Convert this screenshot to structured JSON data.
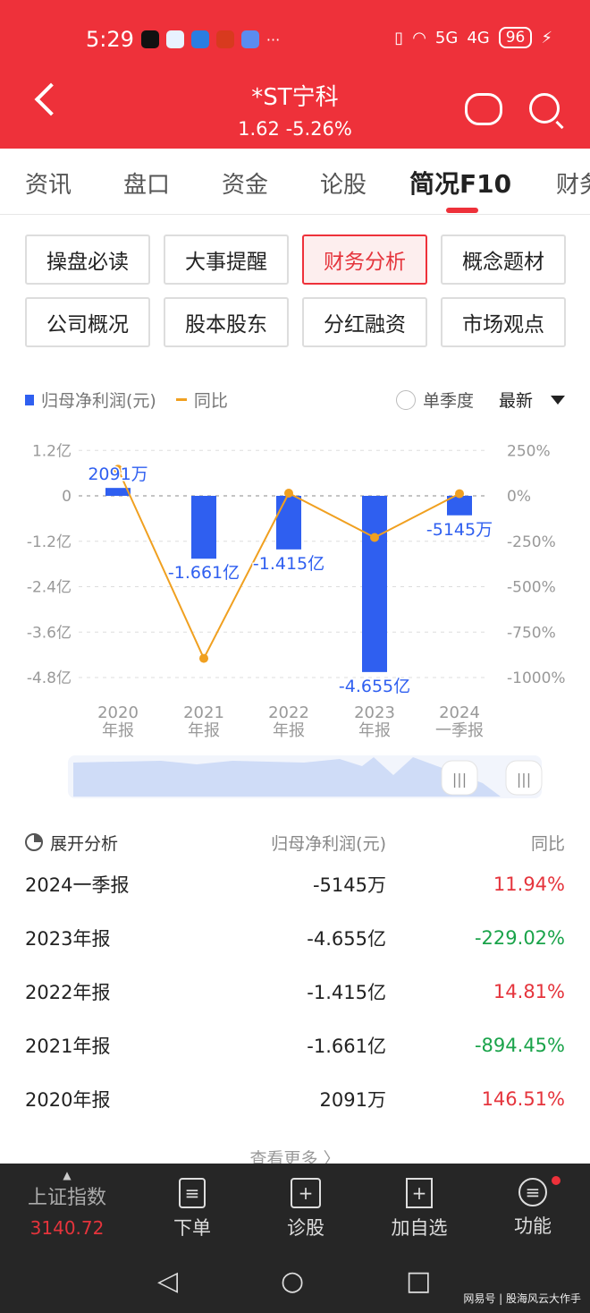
{
  "status_bar": {
    "time": "5:29",
    "battery": "96",
    "network": [
      "5G",
      "4G"
    ]
  },
  "header": {
    "title": "*ST宁科",
    "price": "1.62",
    "change": "-5.26%"
  },
  "tabs": [
    {
      "label": "资讯"
    },
    {
      "label": "盘口"
    },
    {
      "label": "资金"
    },
    {
      "label": "论股"
    },
    {
      "label": "简况F10",
      "active": true
    },
    {
      "label": "财务"
    }
  ],
  "buttons": [
    {
      "label": "操盘必读"
    },
    {
      "label": "大事提醒"
    },
    {
      "label": "财务分析",
      "selected": true
    },
    {
      "label": "概念题材"
    },
    {
      "label": "公司概况"
    },
    {
      "label": "股本股东"
    },
    {
      "label": "分红融资"
    },
    {
      "label": "市场观点"
    }
  ],
  "chart_controls": {
    "single_quarter": "单季度",
    "sort": "最新"
  },
  "chart_data": {
    "type": "bar+line",
    "categories": [
      "2020\n年报",
      "2021\n年报",
      "2022\n年报",
      "2023\n年报",
      "2024\n一季报"
    ],
    "series": [
      {
        "name": "归母净利润(元)",
        "type": "bar",
        "axis": "left",
        "unit": "亿",
        "values": [
          0.2091,
          -1.661,
          -1.415,
          -4.655,
          -0.5145
        ],
        "labels": [
          "2091万",
          "-1.661亿",
          "-1.415亿",
          "-4.655亿",
          "-5145万"
        ],
        "color": "#2f5ff0"
      },
      {
        "name": "同比",
        "type": "line",
        "axis": "right",
        "unit": "%",
        "values": [
          146.51,
          -894.45,
          14.81,
          -229.02,
          11.94
        ],
        "color": "#f0a020"
      }
    ],
    "left_ticks": [
      "1.2亿",
      "0",
      "-1.2亿",
      "-2.4亿",
      "-3.6亿",
      "-4.8亿"
    ],
    "right_ticks": [
      "250%",
      "0%",
      "-250%",
      "-500%",
      "-750%",
      "-1000%"
    ],
    "ylim_left": [
      -4.8,
      1.2
    ],
    "ylim_right": [
      -1000,
      250
    ],
    "grid": true,
    "legend": "top-left"
  },
  "table": {
    "expand": "展开分析",
    "col2": "归母净利润(元)",
    "col3": "同比",
    "rows": [
      {
        "period": "2024一季报",
        "profit": "-5145万",
        "yoy": "11.94%",
        "up": true
      },
      {
        "period": "2023年报",
        "profit": "-4.655亿",
        "yoy": "-229.02%",
        "up": false
      },
      {
        "period": "2022年报",
        "profit": "-1.415亿",
        "yoy": "14.81%",
        "up": true
      },
      {
        "period": "2021年报",
        "profit": "-1.661亿",
        "yoy": "-894.45%",
        "up": false
      },
      {
        "period": "2020年报",
        "profit": "2091万",
        "yoy": "146.51%",
        "up": true
      }
    ],
    "more": "查看更多 〉"
  },
  "bottom_nav": {
    "index_name": "上证指数",
    "index_value": "3140.72",
    "items": [
      {
        "label": "下单"
      },
      {
        "label": "诊股"
      },
      {
        "label": "加自选"
      },
      {
        "label": "功能"
      }
    ]
  },
  "watermark": "网易号 | 股海风云大作手",
  "colors": {
    "brand": "#ee313a",
    "up": "#e5343c",
    "down": "#1aa34a",
    "bar": "#2f5ff0",
    "line": "#f0a020"
  }
}
